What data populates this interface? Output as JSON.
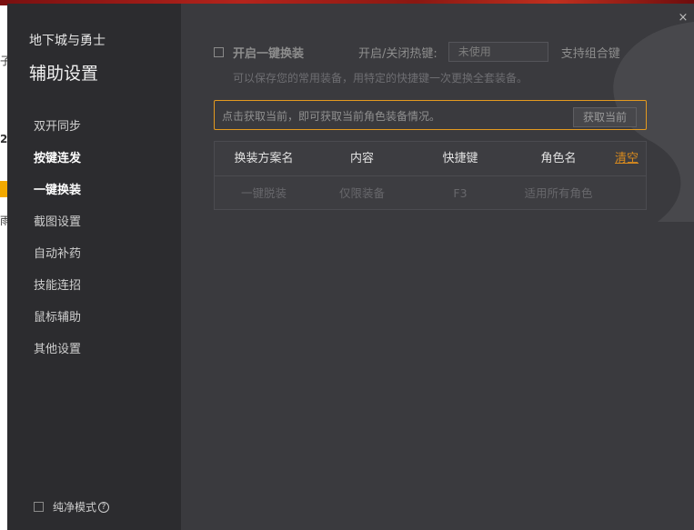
{
  "background": {
    "fragments": [
      "子",
      "2",
      "雨"
    ]
  },
  "sidebar": {
    "app_name": "地下城与勇士",
    "panel_title": "辅助设置",
    "items": [
      {
        "label": "双开同步",
        "bold": false
      },
      {
        "label": "按键连发",
        "bold": true
      },
      {
        "label": "一键换装",
        "bold": true
      },
      {
        "label": "截图设置",
        "bold": false
      },
      {
        "label": "自动补药",
        "bold": false
      },
      {
        "label": "技能连招",
        "bold": false
      },
      {
        "label": "鼠标辅助",
        "bold": false
      },
      {
        "label": "其他设置",
        "bold": false
      }
    ],
    "pure_mode_label": "纯净模式",
    "help_glyph": "?"
  },
  "main": {
    "close_glyph": "×",
    "enable_label": "开启一键换装",
    "enable_checked": false,
    "hotkey_label": "开启/关闭热键:",
    "hotkey_value": "未使用",
    "combo_label": "支持组合键",
    "description": "可以保存您的常用装备，用特定的快捷键一次更换全套装备。",
    "info_text": "点击获取当前，即可获取当前角色装备情况。",
    "fetch_button": "获取当前",
    "table": {
      "headers": [
        "换装方案名",
        "内容",
        "快捷键",
        "角色名"
      ],
      "clear_label": "清空",
      "rows": [
        [
          "一键脱装",
          "仅限装备",
          "F3",
          "适用所有角色"
        ]
      ]
    }
  },
  "colors": {
    "dialog_bg": "#3a3a3e",
    "sidebar_bg": "#2c2c2f",
    "accent": "#e39a1f",
    "link": "#d88a1e"
  }
}
